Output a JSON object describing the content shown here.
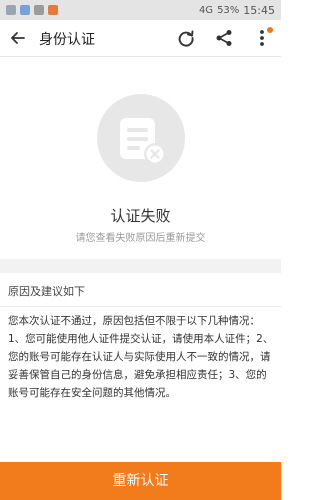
{
  "status_bar": {
    "battery": "53%",
    "time": "15:45",
    "network": "4G"
  },
  "app_bar": {
    "title": "身份认证",
    "back_icon": "arrow-left-icon",
    "refresh_icon": "refresh-icon",
    "share_icon": "share-icon",
    "more_icon": "more-vertical-icon"
  },
  "result": {
    "icon": "document-failed-icon",
    "title": "认证失败",
    "subtitle": "请您查看失败原因后重新提交"
  },
  "reasons": {
    "header": "原因及建议如下",
    "body": "您本次认证不通过，原因包括但不限于以下几种情况：1、您可能使用他人证件提交认证，请使用本人证件；2、您的账号可能存在认证人与实际使用人不一致的情况，请妥善保管自己的身份信息，避免承担相应责任；3、您的账号可能存在安全问题的其他情况。"
  },
  "footer": {
    "resubmit_label": "重新认证"
  },
  "colors": {
    "accent": "#f27c1c",
    "icon_circle": "#e7e7e7"
  }
}
